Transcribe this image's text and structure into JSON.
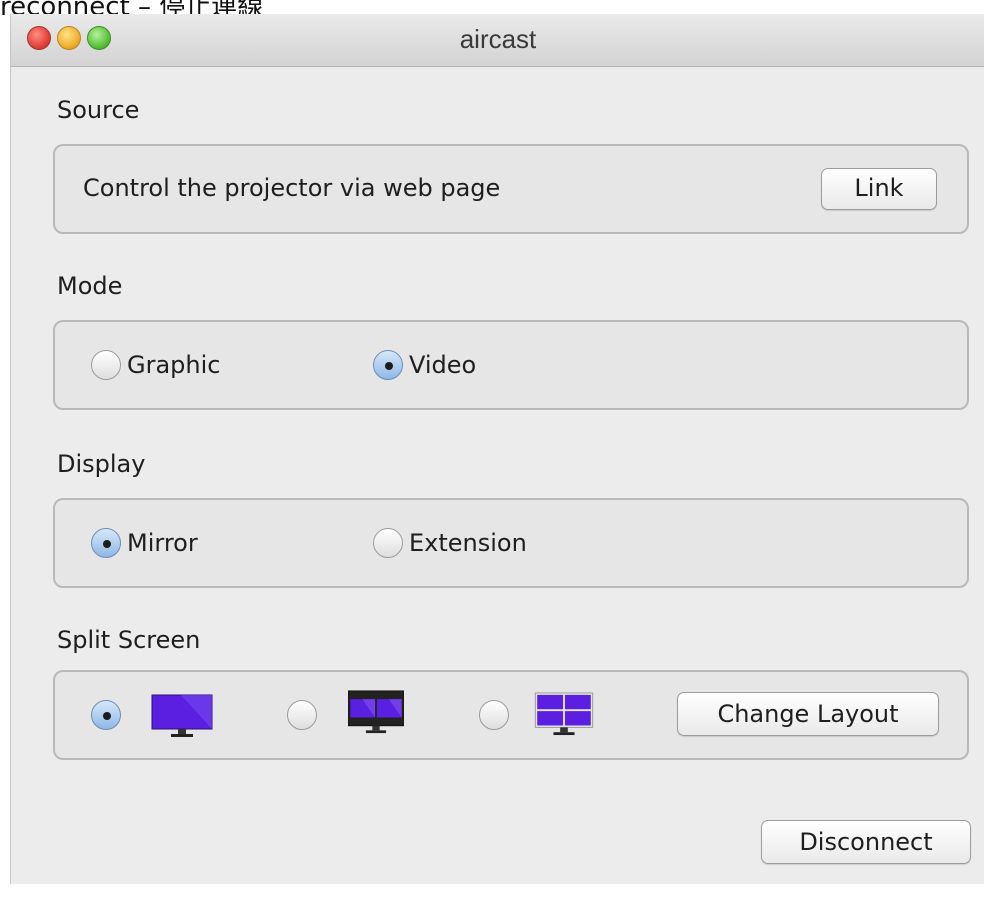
{
  "caption": "reconnect  – 停止連線",
  "window": {
    "title": "aircast"
  },
  "source": {
    "label": "Source",
    "description": "Control the projector via web page",
    "link_button": "Link"
  },
  "mode": {
    "label": "Mode",
    "options": [
      {
        "label": "Graphic",
        "selected": false
      },
      {
        "label": "Video",
        "selected": true
      }
    ]
  },
  "display": {
    "label": "Display",
    "options": [
      {
        "label": "Mirror",
        "selected": true
      },
      {
        "label": "Extension",
        "selected": false
      }
    ]
  },
  "split_screen": {
    "label": "Split Screen",
    "layouts": [
      {
        "icon": "single-screen-monitor-icon",
        "selected": true
      },
      {
        "icon": "dual-split-monitor-icon",
        "selected": false
      },
      {
        "icon": "quad-split-monitor-icon",
        "selected": false
      }
    ],
    "change_layout_button": "Change Layout"
  },
  "disconnect_button": "Disconnect",
  "colors": {
    "accent_blue": "#6d8db5",
    "screen_purple": "#5a1fe0",
    "window_bg": "#ececec"
  }
}
